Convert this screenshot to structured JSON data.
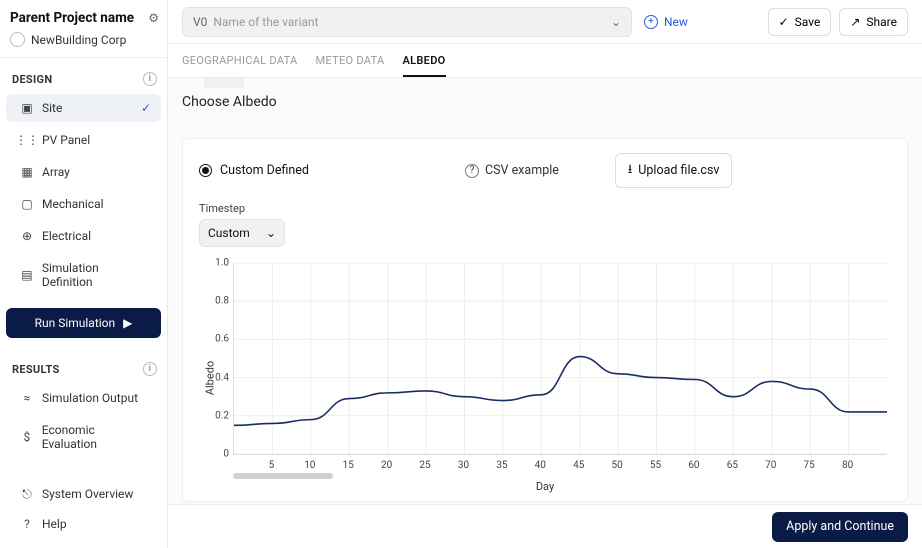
{
  "project": {
    "name": "Parent Project name",
    "org": "NewBuilding Corp"
  },
  "variant": {
    "prefix": "V0",
    "placeholder": "Name of the variant",
    "new_label": "New"
  },
  "top_actions": {
    "save": "Save",
    "share": "Share"
  },
  "sidebar": {
    "design_header": "DESIGN",
    "results_header": "RESULTS",
    "items": [
      {
        "label": "Site"
      },
      {
        "label": "PV Panel"
      },
      {
        "label": "Array"
      },
      {
        "label": "Mechanical"
      },
      {
        "label": "Electrical"
      },
      {
        "label": "Simulation Definition"
      }
    ],
    "run_label": "Run Simulation",
    "results": [
      {
        "label": "Simulation Output"
      },
      {
        "label": "Economic Evaluation"
      }
    ],
    "bottom": [
      {
        "label": "System Overview"
      },
      {
        "label": "Help"
      }
    ]
  },
  "tabs": [
    {
      "label": "GEOGRAPHICAL DATA"
    },
    {
      "label": "METEO DATA"
    },
    {
      "label": "ALBEDO"
    }
  ],
  "section": {
    "title": "Choose Albedo"
  },
  "options": {
    "custom_defined": "Custom Defined",
    "csv_example": "CSV example",
    "upload": "Upload file.csv"
  },
  "timestep": {
    "label": "Timestep",
    "value": "Custom"
  },
  "footer": {
    "apply": "Apply and Continue"
  },
  "chart_data": {
    "type": "line",
    "title": "",
    "xlabel": "Day",
    "ylabel": "Albedo",
    "xlim": [
      0,
      85
    ],
    "ylim": [
      0,
      1.0
    ],
    "y_ticks": [
      0,
      0.2,
      0.4,
      0.6,
      0.8,
      1.0
    ],
    "x_ticks": [
      5,
      10,
      15,
      20,
      25,
      30,
      35,
      40,
      45,
      50,
      55,
      60,
      65,
      70,
      75,
      80
    ],
    "x": [
      0,
      5,
      10,
      15,
      20,
      25,
      30,
      35,
      40,
      45,
      50,
      55,
      60,
      65,
      70,
      75,
      80,
      85
    ],
    "values": [
      0.15,
      0.16,
      0.18,
      0.29,
      0.32,
      0.33,
      0.3,
      0.28,
      0.31,
      0.51,
      0.42,
      0.4,
      0.39,
      0.3,
      0.38,
      0.34,
      0.22,
      0.22
    ]
  }
}
